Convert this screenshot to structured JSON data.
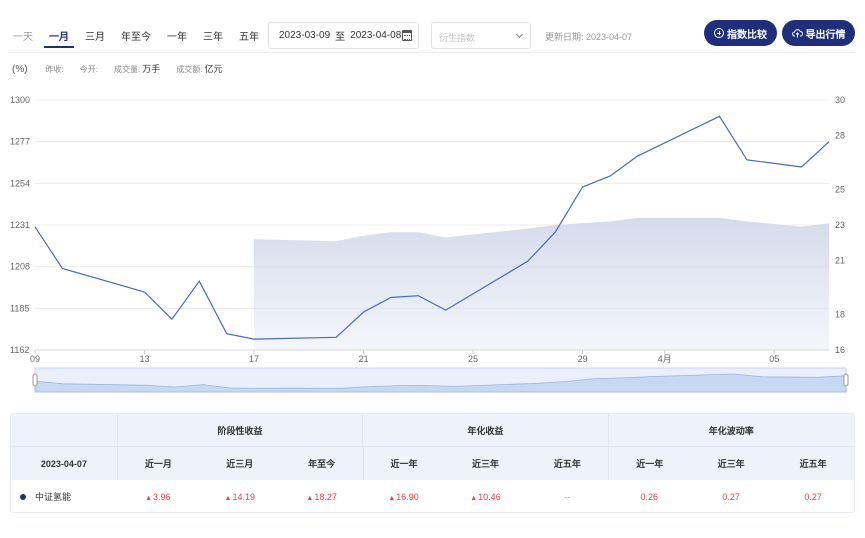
{
  "range_tabs": [
    {
      "label": "一天",
      "active": false
    },
    {
      "label": "一月",
      "active": true
    },
    {
      "label": "三月",
      "active": false
    },
    {
      "label": "年至今",
      "active": false
    },
    {
      "label": "一年",
      "active": false
    },
    {
      "label": "三年",
      "active": false
    },
    {
      "label": "五年",
      "active": false
    }
  ],
  "date_range": {
    "start": "2023-03-09",
    "sep": "至",
    "end": "2023-04-08"
  },
  "derive_select": {
    "placeholder": "衍生指数"
  },
  "update_date": "更新日期: 2023-04-07",
  "buttons": {
    "compare": "指数比较",
    "export": "导出行情"
  },
  "info": {
    "unit": "(%)",
    "prev_close_label": "昨收:",
    "open_label": "今开:",
    "volume_label": "成交量:",
    "volume_unit": "万手",
    "amount_label": "成交额:",
    "amount_unit": "亿元"
  },
  "colors": {
    "accent": "#1f2f7a",
    "line": "#4a6bb5",
    "area": "#d4dbeb",
    "up": "#e64545"
  },
  "chart_data": {
    "type": "line",
    "x_ticks": [
      "09",
      "13",
      "17",
      "21",
      "25",
      "29",
      "4月",
      "05"
    ],
    "left_axis": {
      "ylim": [
        1162,
        1300
      ],
      "ticks": [
        1162,
        1185,
        1208,
        1231,
        1254,
        1277,
        1300
      ]
    },
    "right_axis": {
      "ylim": [
        16,
        30
      ],
      "ticks": [
        16,
        18,
        21,
        23,
        25,
        28,
        30
      ]
    },
    "series": [
      {
        "type": "line",
        "axis": "left",
        "dates": [
          "2023-03-09",
          "2023-03-10",
          "2023-03-13",
          "2023-03-14",
          "2023-03-15",
          "2023-03-16",
          "2023-03-17",
          "2023-03-20",
          "2023-03-21",
          "2023-03-22",
          "2023-03-23",
          "2023-03-24",
          "2023-03-27",
          "2023-03-28",
          "2023-03-29",
          "2023-03-30",
          "2023-03-31",
          "2023-04-03",
          "2023-04-04",
          "2023-04-06",
          "2023-04-07"
        ],
        "values": [
          1230,
          1207,
          1194,
          1179,
          1200,
          1171,
          1168,
          1169,
          1183,
          1191,
          1192,
          1184,
          1211,
          1227,
          1252,
          1258,
          1269,
          1291,
          1267,
          1263,
          1277
        ]
      },
      {
        "type": "area",
        "axis": "right",
        "dates": [
          "2023-03-17",
          "2023-03-20",
          "2023-03-21",
          "2023-03-22",
          "2023-03-23",
          "2023-03-24",
          "2023-03-27",
          "2023-03-28",
          "2023-03-29",
          "2023-03-30",
          "2023-03-31",
          "2023-04-03",
          "2023-04-04",
          "2023-04-06",
          "2023-04-07"
        ],
        "values": [
          22.2,
          22.1,
          22.4,
          22.6,
          22.6,
          22.3,
          22.8,
          23.0,
          23.1,
          23.2,
          23.4,
          23.4,
          23.2,
          22.9,
          23.1
        ]
      }
    ]
  },
  "stats": {
    "group_headers": [
      "阶段性收益",
      "年化收益",
      "年化波动率"
    ],
    "date_label": "2023-04-07",
    "sub_headers": [
      "近一月",
      "近三月",
      "年至今",
      "近一年",
      "近三年",
      "近五年",
      "近一年",
      "近三年",
      "近五年"
    ],
    "row": {
      "name": "中证氢能",
      "period": [
        "3.96",
        "14.19",
        "18.27"
      ],
      "annual_return": [
        "16.90",
        "10.46",
        "--"
      ],
      "annual_vol": [
        "0.26",
        "0.27",
        "0.27"
      ]
    }
  }
}
